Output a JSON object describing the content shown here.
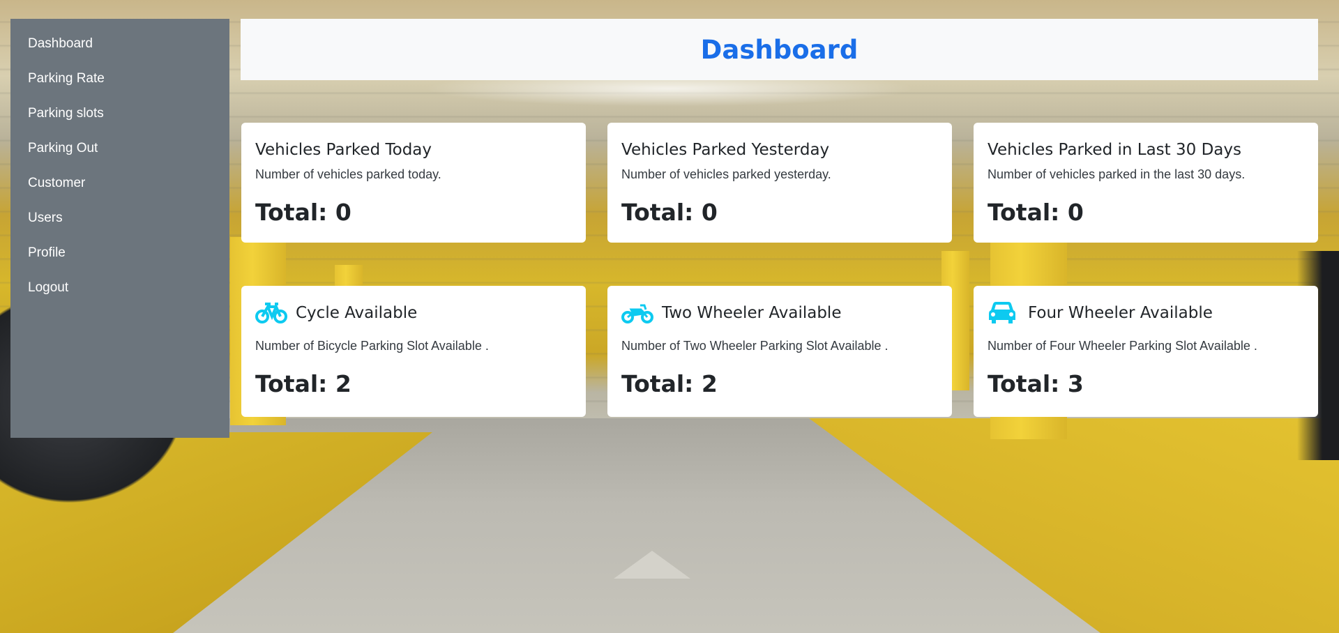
{
  "sidebar": {
    "items": [
      {
        "label": "Dashboard"
      },
      {
        "label": "Parking Rate"
      },
      {
        "label": "Parking slots"
      },
      {
        "label": "Parking Out"
      },
      {
        "label": "Customer"
      },
      {
        "label": "Users"
      },
      {
        "label": "Profile"
      },
      {
        "label": "Logout"
      }
    ]
  },
  "header": {
    "title": "Dashboard",
    "title_color": "#1a6ee8"
  },
  "stats": [
    {
      "title": "Vehicles Parked Today",
      "description": "Number of vehicles parked today.",
      "total": "Total: 0"
    },
    {
      "title": "Vehicles Parked Yesterday",
      "description": "Number of vehicles parked yesterday.",
      "total": "Total: 0"
    },
    {
      "title": "Vehicles Parked in Last 30 Days",
      "description": "Number of vehicles parked in the last 30 days.",
      "total": "Total: 0"
    }
  ],
  "availability": [
    {
      "icon": "bicycle-icon",
      "title": "Cycle Available",
      "description": "Number of Bicycle Parking Slot Available .",
      "total": "Total: 2"
    },
    {
      "icon": "motorcycle-icon",
      "title": "Two Wheeler Available",
      "description": "Number of Two Wheeler Parking Slot Available .",
      "total": "Total: 2"
    },
    {
      "icon": "car-icon",
      "title": "Four Wheeler Available",
      "description": "Number of Four Wheeler Parking Slot Available .",
      "total": "Total: 3"
    }
  ],
  "colors": {
    "sidebar_bg": "#6c757d",
    "icon_accent": "#0dcaf0",
    "card_bg": "#ffffff",
    "header_bg": "#f8f9fa"
  }
}
